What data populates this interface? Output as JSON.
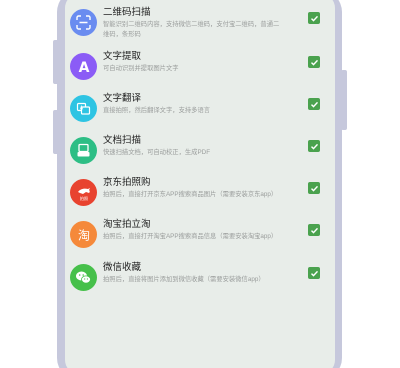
{
  "items": [
    {
      "title": "二维码扫描",
      "desc": "智能识别二维码内容，支持微信二维码，支付宝二维码，普通二维码，条形码",
      "icon": "qr-scan-icon",
      "color": "#6a8cf0",
      "checked": true
    },
    {
      "title": "文字提取",
      "desc": "可自动识别并提取图片文字",
      "icon": "letter-a-icon",
      "color": "#8b5cf6",
      "checked": true
    },
    {
      "title": "文字翻译",
      "desc": "直接拍照，然后翻译文字，支持多语言",
      "icon": "translate-icon",
      "color": "#2ec4e3",
      "checked": true
    },
    {
      "title": "文档扫描",
      "desc": "快速扫描文档，可自动校正，生成PDF",
      "icon": "document-scan-icon",
      "color": "#2dbe85",
      "checked": true
    },
    {
      "title": "京东拍照购",
      "desc": "拍照后，直接打开京东APP搜索商品图片（需要安装京东app）",
      "icon": "jd-dog-icon",
      "color": "#e8432f",
      "checked": true
    },
    {
      "title": "淘宝拍立淘",
      "desc": "拍照后，直接打开淘宝APP搜索商品信息（需要安装淘宝app）",
      "icon": "taobao-icon",
      "color": "#f5893a",
      "checked": true
    },
    {
      "title": "微信收藏",
      "desc": "拍照后，直接将图片添加到微信收藏（需要安装微信app）",
      "icon": "wechat-icon",
      "color": "#46c04a",
      "checked": true
    }
  ]
}
